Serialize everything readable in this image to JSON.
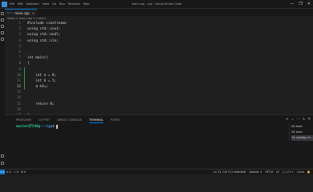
{
  "titlebar": {
    "menus": [
      "File",
      "Edit",
      "Selection",
      "View",
      "Go",
      "Run",
      "Terminal",
      "Help"
    ],
    "window_title": "main.cpp - cpp - Visual Studio Code",
    "controls": [
      "—",
      "❐",
      "✕"
    ]
  },
  "tab": {
    "icon": "C++",
    "label": "main.cpp",
    "close": "×"
  },
  "breadcrumb": "Video > main.cpp > main()",
  "code_lines": [
    {
      "n": "1",
      "text": "#include <iostream>"
    },
    {
      "n": "2",
      "text": "using std::cout;"
    },
    {
      "n": "3",
      "text": "using std::endl;"
    },
    {
      "n": "4",
      "text": "using std::cin;"
    },
    {
      "n": "5",
      "text": ""
    },
    {
      "n": "6",
      "text": ""
    },
    {
      "n": "7",
      "text": "int main()"
    },
    {
      "n": "8",
      "text": "{"
    },
    {
      "n": "9",
      "text": ""
    },
    {
      "n": "10",
      "text": "    int a = 0;"
    },
    {
      "n": "11",
      "text": "    int b = 5;"
    },
    {
      "n": "12",
      "text": "    a %I=;"
    },
    {
      "n": "13",
      "text": ""
    },
    {
      "n": "14",
      "text": ""
    },
    {
      "n": "15",
      "text": "    return 0;"
    },
    {
      "n": "16",
      "text": ""
    },
    {
      "n": "17",
      "text": "}"
    },
    {
      "n": "18",
      "text": ""
    }
  ],
  "panel": {
    "tabs": [
      "PROBLEMS",
      "OUTPUT",
      "DEBUG CONSOLE",
      "TERMINAL",
      "PORTS"
    ],
    "active_tab": "TERMINAL",
    "controls": [
      "+",
      "⌄",
      "⋯",
      "∧",
      "✕"
    ]
  },
  "terminal": {
    "user": "master@T540p",
    "sep": ":",
    "path": "~/cpp",
    "prompt": "$ "
  },
  "terminal_list": [
    {
      "icon": "⌨",
      "label": "bash"
    },
    {
      "icon": "⌨",
      "label": "bash"
    },
    {
      "icon": "⌨",
      "label": "cppdbg: m…"
    }
  ],
  "statusbar": {
    "remote": "><",
    "left": [
      "⊗ 0",
      "⚠ 0",
      "⚙ 0"
    ],
    "right": [
      "Ln 11, Col 3 (1 selected)",
      "Spaces: 4",
      "UTF-8",
      "LF",
      "{ } C++",
      "Linux",
      "🔔"
    ]
  }
}
